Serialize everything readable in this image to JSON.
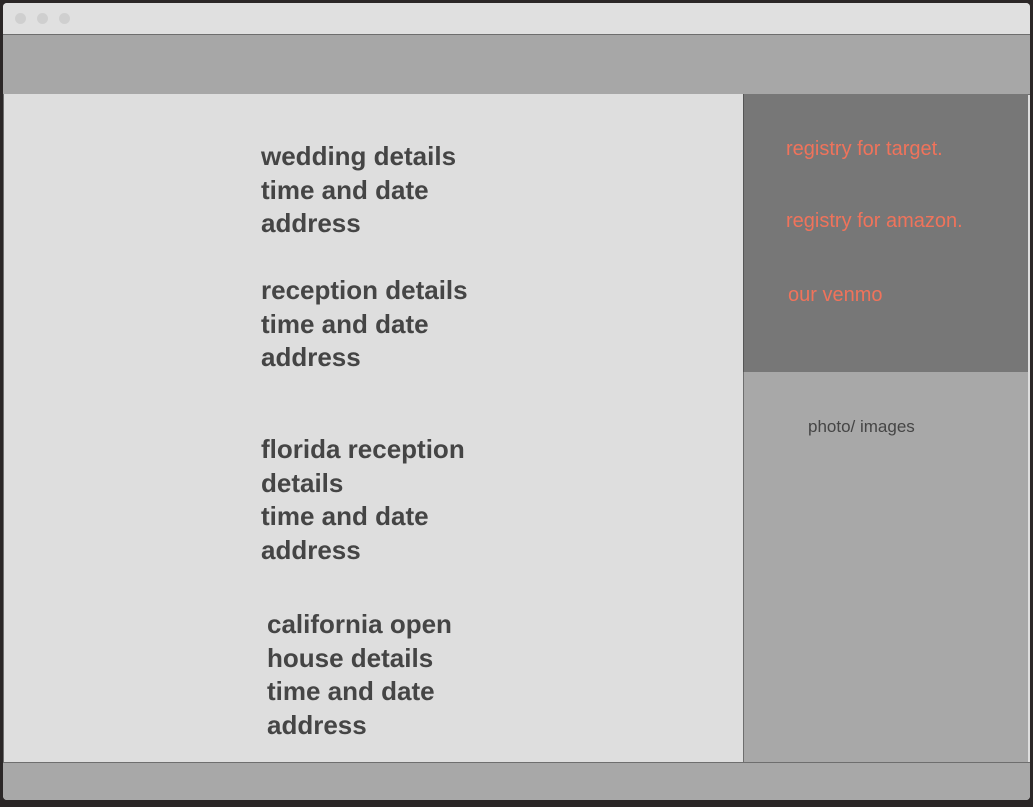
{
  "sections": [
    {
      "lines": [
        "wedding details",
        "time and date",
        "address"
      ]
    },
    {
      "lines": [
        "reception details",
        "time and date",
        "address"
      ]
    },
    {
      "lines": [
        "florida reception",
        "details",
        "time and date",
        "address"
      ]
    },
    {
      "lines": [
        "california open",
        "house details",
        "time and date",
        "address"
      ]
    }
  ],
  "sidebar": {
    "links": [
      "registry for target.",
      "registry for amazon.",
      "our venmo"
    ],
    "photo_label": "photo/ images"
  },
  "colors": {
    "link": "#f0735b",
    "body_text": "#454545"
  }
}
